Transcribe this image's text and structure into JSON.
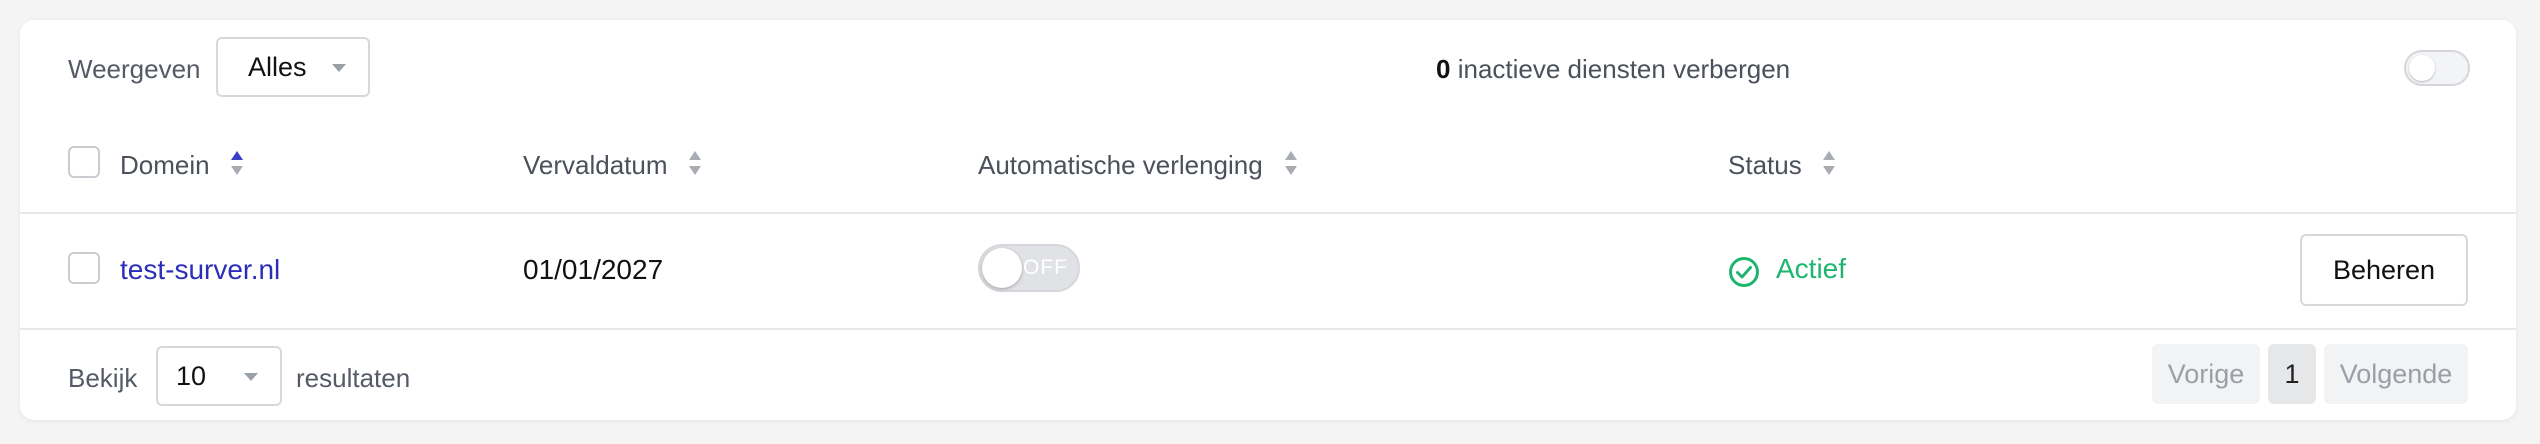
{
  "toolbar": {
    "show_label": "Weergeven",
    "show_select_value": "Alles",
    "inactive_count": "0",
    "inactive_label": "inactieve diensten verbergen"
  },
  "table": {
    "columns": [
      "Domein",
      "Vervaldatum",
      "Automatische verlenging",
      "Status"
    ],
    "rows": [
      {
        "domain": "test-surver.nl",
        "expiry": "01/01/2027",
        "auto_renew": "OFF",
        "status": "Actief",
        "action": "Beheren"
      }
    ]
  },
  "footer": {
    "show_label": "Bekijk",
    "page_size": "10",
    "results_label": "resultaten",
    "prev_label": "Vorige",
    "current_page": "1",
    "next_label": "Volgende"
  },
  "colors": {
    "link": "#2b2fb8",
    "status_active": "#1db56f",
    "sort_active": "#3b3fc7",
    "sort_inactive": "#a8acb3"
  },
  "icons": {
    "status": "check-circle-icon",
    "sort": "sort-arrows-icon",
    "dropdown": "caret-down-icon"
  }
}
